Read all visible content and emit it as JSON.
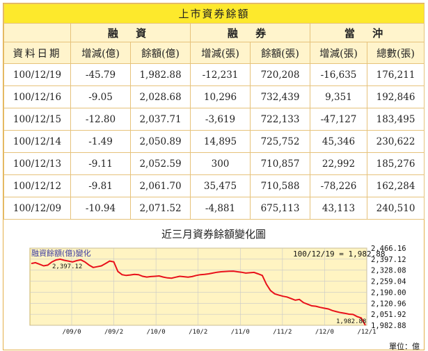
{
  "title": "上市資券餘額",
  "groups": [
    "融 資",
    "融 券",
    "當 沖"
  ],
  "headers": [
    "資料日期",
    "增減(億)",
    "餘額(億)",
    "增減(張)",
    "餘額(張)",
    "增減(張)",
    "總數(張)"
  ],
  "rows": [
    [
      "100/12/19",
      "-45.79",
      "1,982.88",
      "-12,231",
      "720,208",
      "-16,635",
      "176,211"
    ],
    [
      "100/12/16",
      "-9.05",
      "2,028.68",
      "10,296",
      "732,439",
      "9,351",
      "192,846"
    ],
    [
      "100/12/15",
      "-12.80",
      "2,037.71",
      "-3,619",
      "722,133",
      "-47,127",
      "183,495"
    ],
    [
      "100/12/14",
      "-1.49",
      "2,050.89",
      "14,895",
      "725,752",
      "45,346",
      "230,622"
    ],
    [
      "100/12/13",
      "-9.11",
      "2,052.59",
      "300",
      "710,857",
      "22,992",
      "185,276"
    ],
    [
      "100/12/12",
      "-9.81",
      "2,061.70",
      "35,475",
      "710,588",
      "-78,226",
      "162,284"
    ],
    [
      "100/12/09",
      "-10.94",
      "2,071.52",
      "-4,881",
      "675,113",
      "43,113",
      "240,510"
    ]
  ],
  "chart_title": "近三月資券餘額變化圖",
  "colors": {
    "line": "#e8101a",
    "plot_bg": "#fff4c2",
    "grid": "#c8c8c8",
    "accent": "#fde92c"
  },
  "chart_data": {
    "type": "line",
    "title": "近三月資券餘額變化圖",
    "ylabel": "融資餘額(億)變化",
    "readout": "100/12/19 = 1,982.88",
    "max_label": "2,397.12",
    "min_label": "1,982.88",
    "unit_label": "單位：億",
    "ylim": [
      1982.88,
      2466.16
    ],
    "y_ticks": [
      "2,466.16",
      "2,397.12",
      "2,328.08",
      "2,259.04",
      "2,190.00",
      "2,120.96",
      "2,051.92",
      "1,982.88"
    ],
    "y_tick_values": [
      2466.16,
      2397.12,
      2328.08,
      2259.04,
      2190.0,
      2120.96,
      2051.92,
      1982.88
    ],
    "x_ticks": [
      "/09/0",
      "/09/2",
      "/10/0",
      "/10/2",
      "/11/0",
      "/11/2",
      "/12/0",
      "/12/1"
    ],
    "grid": true,
    "series": [
      {
        "values": [
          2370,
          2375,
          2365,
          2355,
          2360,
          2380,
          2392,
          2397.12,
          2390,
          2385,
          2380,
          2388,
          2393,
          2380,
          2360,
          2345,
          2350,
          2355,
          2370,
          2385,
          2380,
          2320,
          2300,
          2295,
          2298,
          2302,
          2300,
          2290,
          2285,
          2288,
          2290,
          2292,
          2285,
          2280,
          2278,
          2284,
          2290,
          2287,
          2284,
          2288,
          2295,
          2300,
          2302,
          2305,
          2310,
          2315,
          2318,
          2320,
          2321,
          2322,
          2318,
          2315,
          2310,
          2312,
          2314,
          2305,
          2295,
          2240,
          2200,
          2180,
          2172,
          2165,
          2160,
          2150,
          2140,
          2145,
          2125,
          2115,
          2105,
          2102,
          2095,
          2090,
          2085,
          2075,
          2068,
          2062,
          2058,
          2052.59,
          2050.89,
          2037.71,
          2028.68,
          1982.88
        ]
      }
    ]
  }
}
